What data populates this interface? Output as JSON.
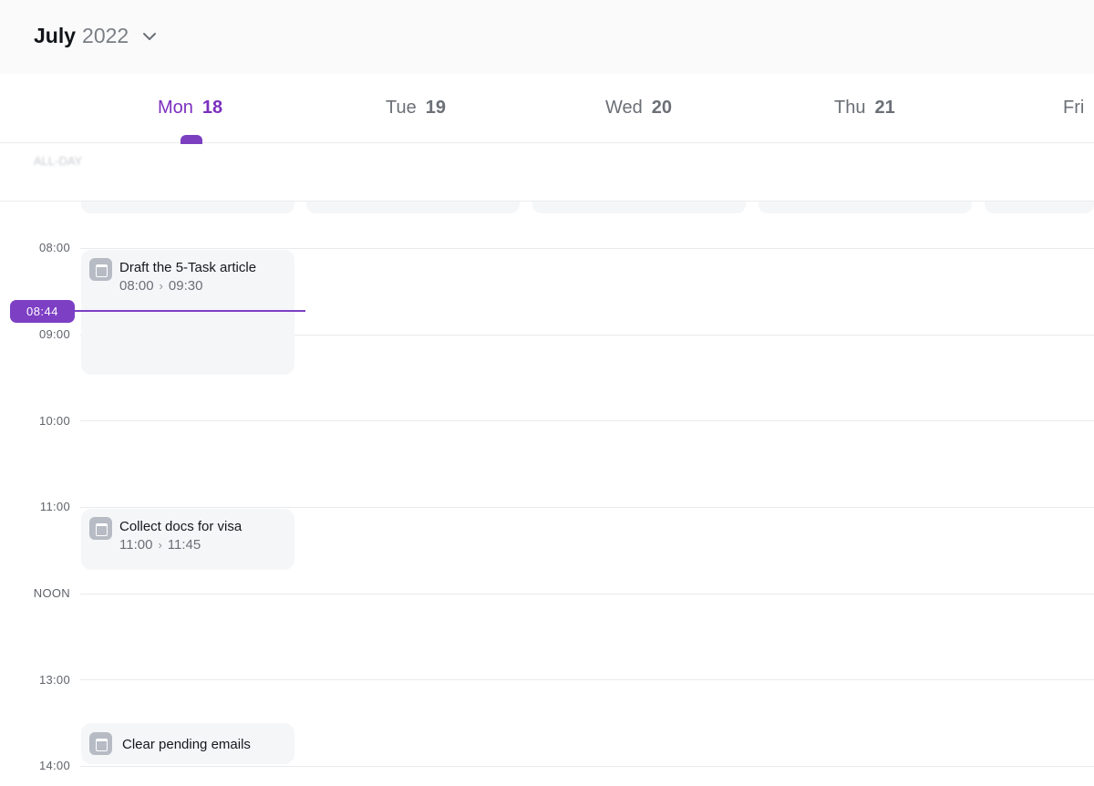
{
  "header": {
    "month": "July",
    "year": "2022",
    "dropdown_icon": "chevron-down-icon"
  },
  "days": [
    {
      "dow": "Mon",
      "num": "18",
      "today": true
    },
    {
      "dow": "Tue",
      "num": "19"
    },
    {
      "dow": "Wed",
      "num": "20"
    },
    {
      "dow": "Thu",
      "num": "21"
    },
    {
      "dow": "Fri",
      "num": ""
    }
  ],
  "allday": {
    "label": "ALL-DAY"
  },
  "times": [
    "08:00",
    "09:00",
    "10:00",
    "11:00",
    "NOON",
    "13:00",
    "14:00"
  ],
  "now": {
    "label": "08:44"
  },
  "events": [
    {
      "title": "Draft the 5-Task article",
      "start": "08:00",
      "end": "09:30",
      "icon": "calendar-icon"
    },
    {
      "title": "Collect docs for visa",
      "start": "11:00",
      "end": "11:45",
      "icon": "calendar-icon"
    },
    {
      "title": "Clear pending emails",
      "icon": "calendar-icon"
    }
  ],
  "colors": {
    "accent": "#7d3fc4",
    "event_bg": "#f5f6f8",
    "grid": "#e9eaed"
  }
}
